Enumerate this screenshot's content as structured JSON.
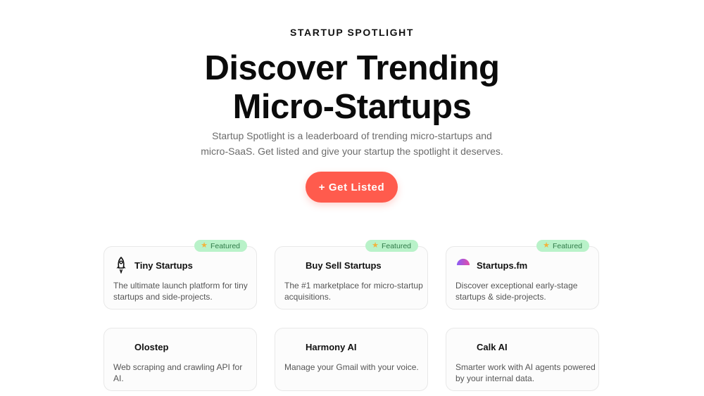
{
  "hero": {
    "eyebrow": "STARTUP SPOTLIGHT",
    "title_line1": "Discover Trending",
    "title_line2": "Micro-Startups",
    "subtitle": "Startup Spotlight is a leaderboard of trending micro-startups and micro-SaaS. Get listed and give your startup the spotlight it deserves.",
    "cta_label": "+ Get Listed"
  },
  "badge_label": "Featured",
  "cards": [
    {
      "name": "Tiny Startups",
      "description": "The ultimate launch platform for tiny startups and side-projects.",
      "featured": true,
      "icon": "rocket-icon"
    },
    {
      "name": "Buy Sell Startups",
      "description": "The #1 marketplace for micro-startup acquisitions.",
      "featured": true,
      "icon": ""
    },
    {
      "name": "Startups.fm",
      "description": "Discover exceptional early-stage startups & side-projects.",
      "featured": true,
      "icon": "startupsfm-logo-icon"
    },
    {
      "name": "Olostep",
      "description": "Web scraping and crawling API for AI.",
      "featured": false,
      "icon": ""
    },
    {
      "name": "Harmony AI",
      "description": "Manage your Gmail with your voice.",
      "featured": false,
      "icon": ""
    },
    {
      "name": "Calk AI",
      "description": "Smarter work with AI agents powered by your internal data.",
      "featured": false,
      "icon": ""
    }
  ],
  "colors": {
    "accent": "#ff5b4d",
    "badge_bg": "#b9f2c9",
    "badge_text": "#2f7a48",
    "star": "#f2b33d"
  }
}
